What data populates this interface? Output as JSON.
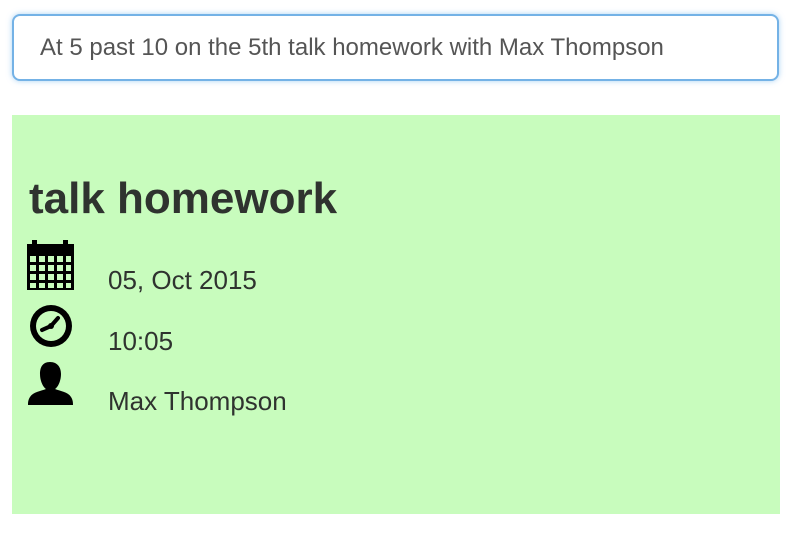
{
  "entry": {
    "value": "At 5 past 10 on the 5th talk homework with Max Thompson"
  },
  "event_card": {
    "title": "talk homework",
    "date": "05, Oct 2015",
    "time": "10:05",
    "person": "Max Thompson",
    "background_color": "#c8fcbd",
    "icons": [
      "calendar-icon",
      "clock-icon",
      "user-icon"
    ]
  }
}
